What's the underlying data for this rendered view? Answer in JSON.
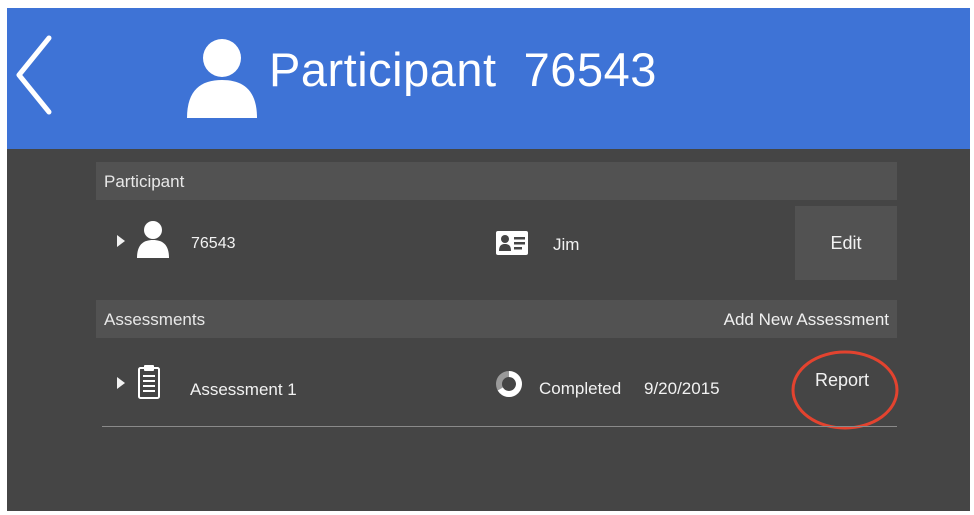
{
  "header": {
    "title": "Participant  76543",
    "back_icon": "chevron-left-icon",
    "user_icon": "user-icon",
    "bg_color": "#3e73d6"
  },
  "participant_section": {
    "label": "Participant",
    "row": {
      "id": "76543",
      "name": "Jim",
      "edit_label": "Edit"
    }
  },
  "assessments_section": {
    "label": "Assessments",
    "add_label": "Add New Assessment",
    "items": [
      {
        "name": "Assessment 1",
        "status": "Completed",
        "date": "9/20/2015",
        "report_label": "Report"
      }
    ]
  },
  "colors": {
    "panel": "#454545",
    "section": "#525252",
    "highlight_circle": "#e3432f"
  }
}
